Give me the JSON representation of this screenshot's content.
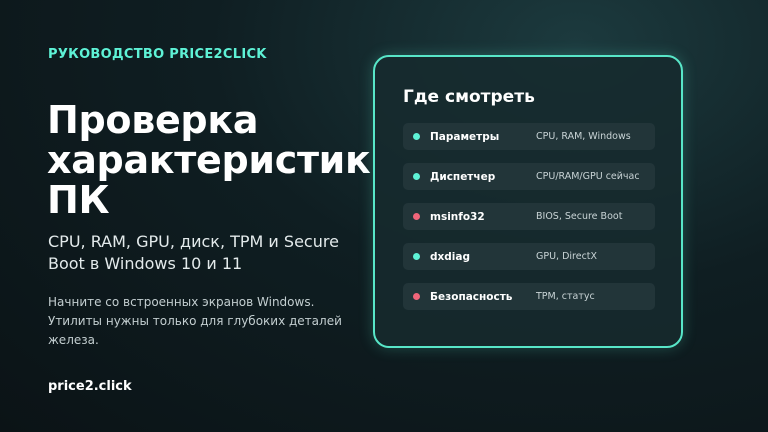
{
  "kicker": "РУКОВОДСТВО PRICE2CLICK",
  "title": "Проверка характеристик ПК",
  "subtitle": "CPU, RAM, GPU, диск, TPM и Secure Boot в Windows 10 и 11",
  "description": "Начните со встроенных экранов Windows. Утилиты нужны только для глубоких деталей железа.",
  "footer_brand": "price2.click",
  "card": {
    "title": "Где смотреть",
    "items": [
      {
        "label": "Параметры",
        "value": "CPU, RAM, Windows",
        "dot_color": "#5ef2d6"
      },
      {
        "label": "Диспетчер",
        "value": "CPU/RAM/GPU сейчас",
        "dot_color": "#5ef2d6"
      },
      {
        "label": "msinfo32",
        "value": "BIOS, Secure Boot",
        "dot_color": "#f0657a"
      },
      {
        "label": "dxdiag",
        "value": "GPU, DirectX",
        "dot_color": "#5ef2d6"
      },
      {
        "label": "Безопасность",
        "value": "TPM, статус",
        "dot_color": "#f0657a"
      }
    ]
  },
  "colors": {
    "accent": "#5ef2d6",
    "warning": "#f0657a",
    "card_border": "#58e6c8"
  }
}
